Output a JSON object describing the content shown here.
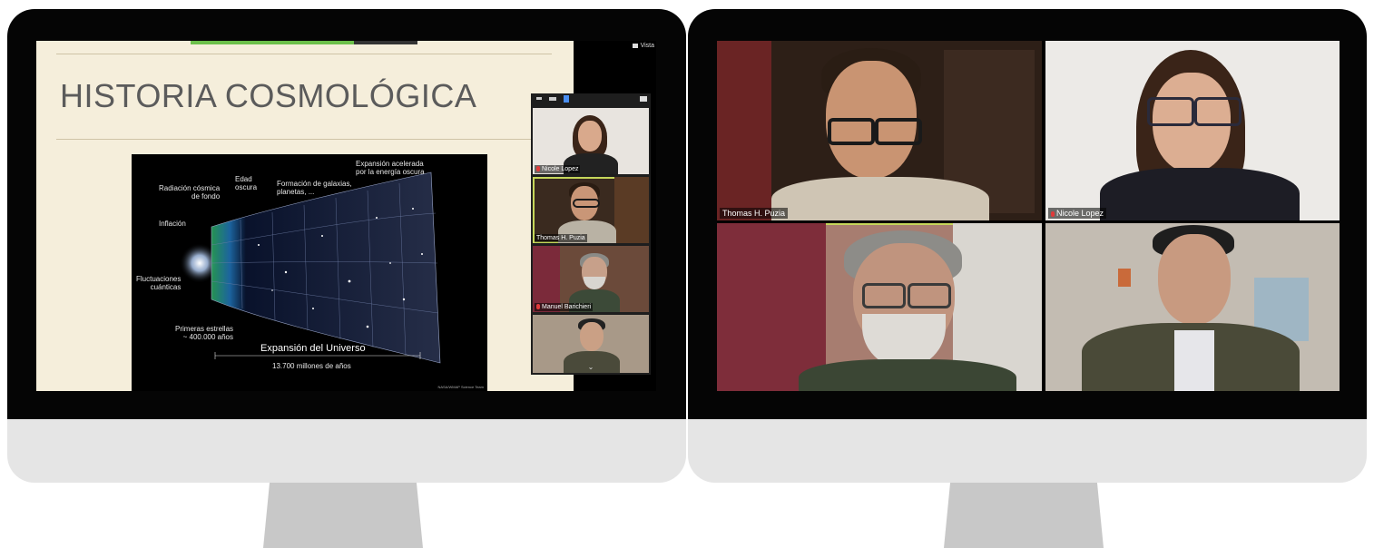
{
  "left_screen": {
    "vista_label": "Vista",
    "slide": {
      "title": "HISTORIA COSMOLÓGICA",
      "figure": {
        "labels": {
          "expansion_acelerada": "Expansión acelerada\npor la energía oscura",
          "edad_oscura": "Edad\noscura",
          "formacion": "Formación de galaxias,\nplanetas, ...",
          "radiacion": "Radiación cósmica\nde fondo",
          "inflacion": "Inflación",
          "fluctuaciones": "Fluctuaciones\ncuánticas",
          "primeras_estrellas": "Primeras estrellas\n~ 400.000 años",
          "expansion_universo": "Expansión del Universo",
          "duracion": "13.700 millones de años",
          "credit": "NASA/WMAP Science Team"
        }
      }
    },
    "filmstrip": {
      "participants": [
        {
          "name": "Nicole Lopez",
          "muted": true
        },
        {
          "name": "Thomas H. Puzia",
          "muted": false,
          "active": true
        },
        {
          "name": "Manuel Barichieri",
          "muted": true
        },
        {
          "name": "",
          "muted": false
        }
      ]
    }
  },
  "right_screen": {
    "participants": [
      {
        "name": "Thomas H. Puzia",
        "muted": false
      },
      {
        "name": "Nicole Lopez",
        "muted": true
      },
      {
        "name": "",
        "muted": false,
        "active": true
      },
      {
        "name": "",
        "muted": false
      }
    ]
  },
  "colors": {
    "bezel": "#050505",
    "chin": "#e5e5e5",
    "stand": "#c8c8c8",
    "slide_bg": "#f5eedb",
    "active_speaker": "#c5d65a",
    "muted_icon": "#e03a3a"
  }
}
